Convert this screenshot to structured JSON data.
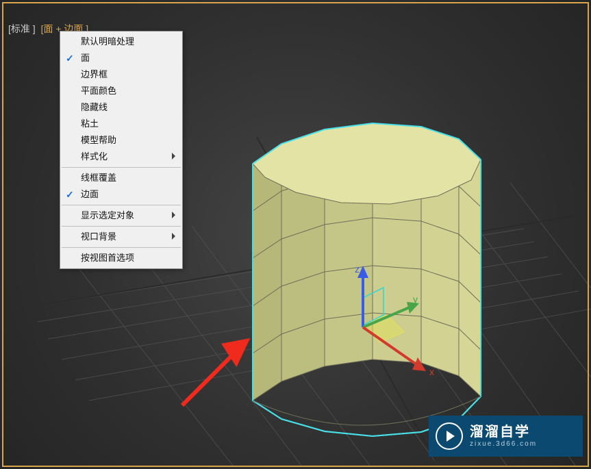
{
  "viewport": {
    "label_standard": "[标准 ]",
    "label_shading": "[面 + 边面 ]"
  },
  "menu": {
    "items": [
      {
        "label": "默认明暗处理",
        "checked": false,
        "separator_after": false,
        "has_submenu": false
      },
      {
        "label": "面",
        "checked": true,
        "separator_after": false,
        "has_submenu": false
      },
      {
        "label": "边界框",
        "checked": false,
        "separator_after": false,
        "has_submenu": false
      },
      {
        "label": "平面颜色",
        "checked": false,
        "separator_after": false,
        "has_submenu": false
      },
      {
        "label": "隐藏线",
        "checked": false,
        "separator_after": false,
        "has_submenu": false
      },
      {
        "label": "粘土",
        "checked": false,
        "separator_after": false,
        "has_submenu": false
      },
      {
        "label": "模型帮助",
        "checked": false,
        "separator_after": false,
        "has_submenu": false
      },
      {
        "label": "样式化",
        "checked": false,
        "separator_after": true,
        "has_submenu": true
      },
      {
        "label": "线框覆盖",
        "checked": false,
        "separator_after": false,
        "has_submenu": false
      },
      {
        "label": "边面",
        "checked": true,
        "separator_after": true,
        "has_submenu": false
      },
      {
        "label": "显示选定对象",
        "checked": false,
        "separator_after": true,
        "has_submenu": true
      },
      {
        "label": "视口背景",
        "checked": false,
        "separator_after": true,
        "has_submenu": true
      },
      {
        "label": "按视图首选项",
        "checked": false,
        "separator_after": false,
        "has_submenu": false
      }
    ]
  },
  "gizmo": {
    "axes": {
      "x": "x",
      "y": "y",
      "z": "z"
    },
    "colors": {
      "x": "#d23a2e",
      "y": "#4aa54a",
      "z": "#3a5be8"
    }
  },
  "watermark": {
    "title": "溜溜自学",
    "url": "zixue.3d66.com"
  },
  "object": {
    "type": "cylinder",
    "sides": 12,
    "height_segments": 5,
    "fill": "#dcdc9a",
    "edge": "#1d1d1d",
    "selection_outline": "#48e0e8"
  }
}
